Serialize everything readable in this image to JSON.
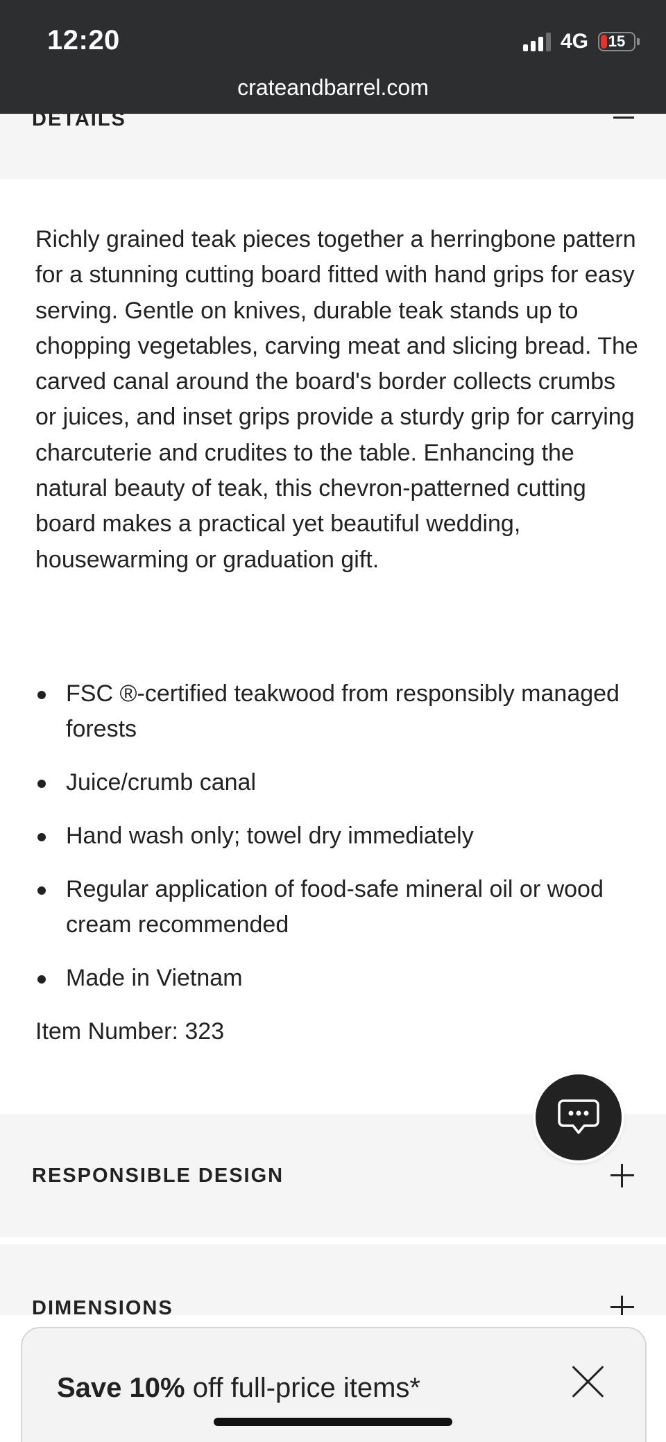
{
  "status_bar": {
    "time": "12:20",
    "network": "4G",
    "battery_level": "15",
    "battery_fraction": 0.15
  },
  "browser": {
    "url": "crateandbarrel.com"
  },
  "details": {
    "title": "DETAILS",
    "description": "Richly grained teak pieces together a herringbone pattern for a stunning cutting board fitted with hand grips for easy serving. Gentle on knives, durable teak stands up to chopping vegetables, carving meat and slicing bread. The carved canal around the board's border collects crumbs or juices, and inset grips provide a sturdy grip for carrying charcuterie and crudites to the table. Enhancing the natural beauty of teak, this chevron-patterned cutting board makes a practical yet beautiful wedding, housewarming or graduation gift.",
    "features": [
      "FSC ®-certified teakwood from responsibly managed forests",
      "Juice/crumb canal",
      "Hand wash only; towel dry immediately",
      "Regular application of food-safe mineral oil or wood cream recommended",
      "Made in Vietnam"
    ],
    "item_number": "Item Number: 323"
  },
  "accordions": {
    "responsible_design": "RESPONSIBLE DESIGN",
    "dimensions": "DIMENSIONS"
  },
  "promo": {
    "bold_text": "Save 10%",
    "rest_text": " off full-price items*"
  },
  "colors": {
    "status_bar_bg": "#2c2e30",
    "accordion_bg": "#f5f5f5",
    "chat_fab_bg": "#222222",
    "battery_low": "#e5352b"
  }
}
